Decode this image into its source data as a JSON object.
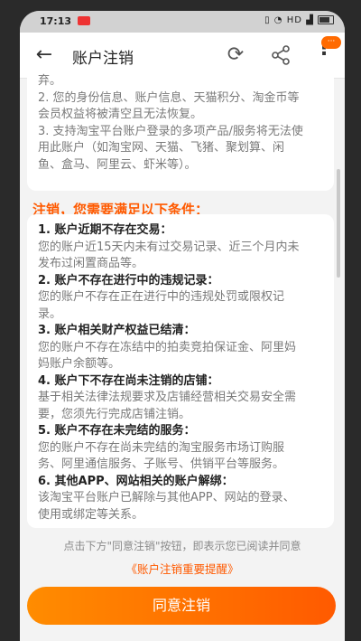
{
  "status": {
    "time": "17:13",
    "signal_text": "HD"
  },
  "appbar": {
    "title": "账户注销",
    "back": "←",
    "refresh": "⟳",
    "more": "⋮",
    "badge": "···"
  },
  "card1": {
    "lines": [
      "弃。",
      "2. 您的身份信息、账户信息、天猫积分、淘金币等",
      "会员权益将被清空且无法恢复。",
      "3. 支持淘宝平台账户登录的多项产品/服务将无法使",
      "用此账户（如淘宝网、天猫、飞猪、聚划算、闲",
      "鱼、盒马、阿里云、虾米等）。"
    ]
  },
  "section_heading": "注销，您需要满足以下条件：",
  "conditions": [
    {
      "title": "1. 账户近期不存在交易：",
      "body": [
        "您的账户近15天内未有过交易记录、近三个月内未",
        "发布过闲置商品等。"
      ]
    },
    {
      "title": "2. 账户不存在进行中的违规记录：",
      "body": [
        "您的账户不存在正在进行中的违规处罚或限权记",
        "录。"
      ]
    },
    {
      "title": "3. 账户相关财产权益已结清：",
      "body": [
        "您的账户不存在冻结中的拍卖竞拍保证金、阿里妈",
        "妈账户余额等。"
      ]
    },
    {
      "title": "4. 账户下不存在尚未注销的店铺：",
      "body": [
        "基于相关法律法规要求及店铺经营相关交易安全需",
        "要，您须先行完成店铺注销。"
      ]
    },
    {
      "title": "5. 账户不存在未完结的服务：",
      "body": [
        "您的账户不存在尚未完结的淘宝服务市场订购服",
        "务、阿里通信服务、子账号、供销平台等服务。"
      ]
    },
    {
      "title": "6. 其他APP、网站相关的账户解绑：",
      "body": [
        "该淘宝平台账户已解除与其他APP、网站的登录、",
        "使用或绑定等关系。"
      ]
    }
  ],
  "notice": "点击下方\"同意注销\"按钮，即表示您已阅读并同意",
  "notice_link": "《账户注销重要提醒》",
  "confirm_button": "同意注销"
}
